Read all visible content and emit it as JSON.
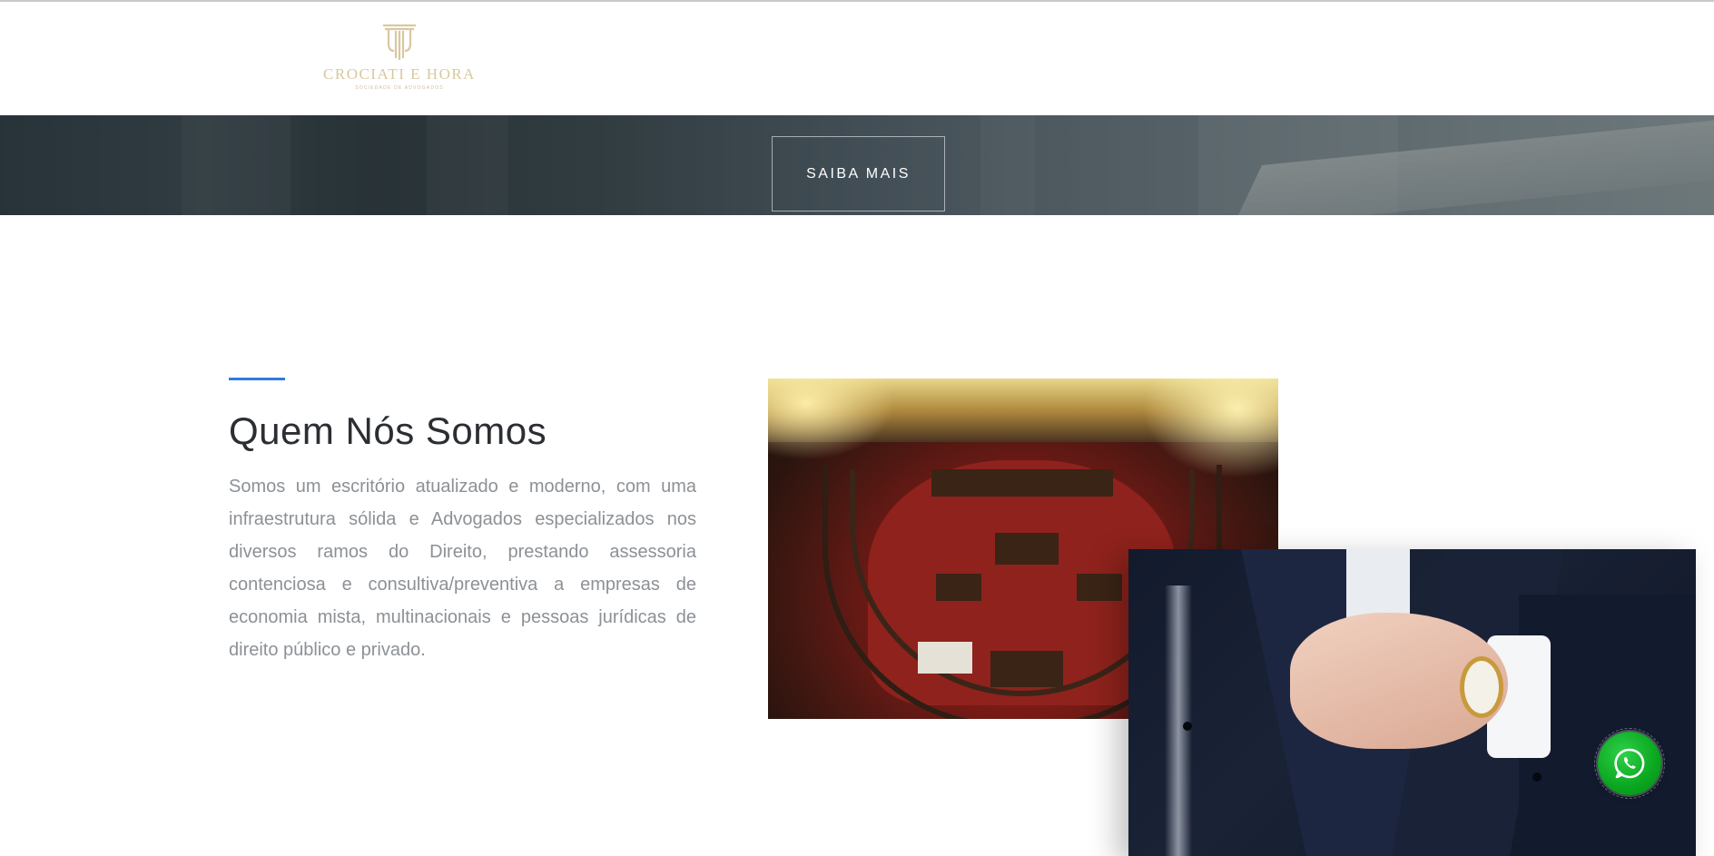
{
  "header": {
    "logo_name": "CROCIATI E HORA",
    "logo_sub": "SOCIEDADE DE ADVOGADOS"
  },
  "hero": {
    "button_label": "SAIBA MAIS"
  },
  "about": {
    "title": "Quem Nós Somos",
    "text": "Somos um escritório atualizado e moderno, com uma infraestrutura sólida e Advogados especializados nos diversos ramos do Direito, prestando assessoria contenciosa e consultiva/preventiva a empresas de economia mista, multinacionais e pessoas jurídicas de direito público e privado."
  },
  "colors": {
    "accent": "#2f7ce6",
    "logo_gold": "#d9c7a0",
    "title": "#2b2e33",
    "body_text": "#8c9196",
    "whatsapp": "#0aa61f"
  },
  "icons": {
    "logo": "column-icon",
    "chat": "whatsapp-icon"
  }
}
